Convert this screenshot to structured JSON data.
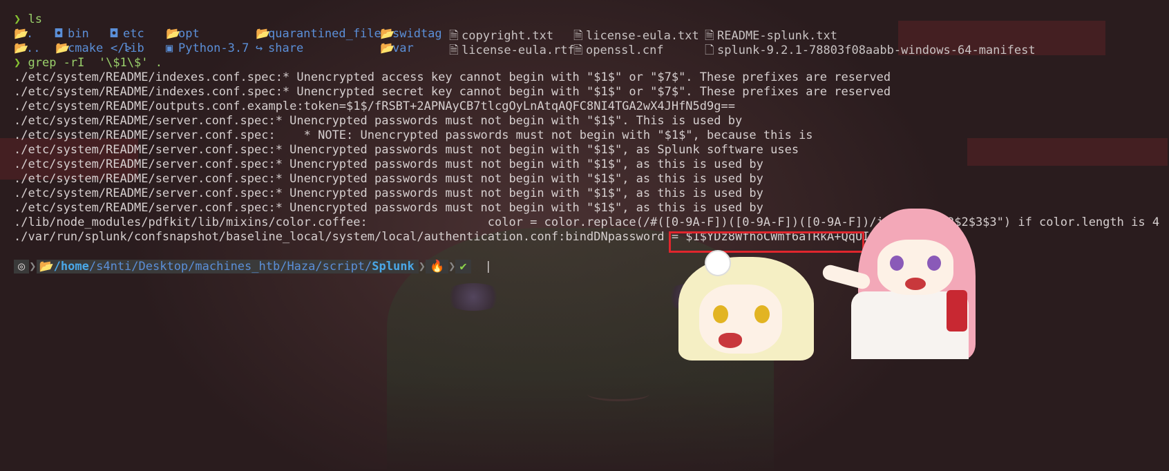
{
  "prompt_symbol": "❯",
  "commands": {
    "ls": "ls",
    "grep": "grep -rI  '\\$1\\$' ."
  },
  "ls_rows": [
    [
      {
        "icon": "📂",
        "name": ".",
        "kind": "dir"
      },
      {
        "icon": "◘",
        "name": "bin",
        "kind": "dir"
      },
      {
        "icon": "◘",
        "name": "etc",
        "kind": "dir"
      },
      {
        "icon": "📂",
        "name": "opt",
        "kind": "dir"
      },
      {
        "icon": "📂",
        "name": "quarantined_files",
        "kind": "dir"
      },
      {
        "icon": "📂",
        "name": "swidtag",
        "kind": "dir"
      },
      {
        "icon": "🗎",
        "name": "copyright.txt",
        "kind": "file"
      },
      {
        "icon": "🗎",
        "name": "license-eula.txt",
        "kind": "file"
      },
      {
        "icon": "🗎",
        "name": "README-splunk.txt",
        "kind": "file"
      }
    ],
    [
      {
        "icon": "📂",
        "name": "..",
        "kind": "dir"
      },
      {
        "icon": "📂",
        "name": "cmake",
        "kind": "dir"
      },
      {
        "icon": "</>",
        "name": "lib",
        "kind": "dir"
      },
      {
        "icon": "▣",
        "name": "Python-3.7",
        "kind": "dir"
      },
      {
        "icon": "↪",
        "name": "share",
        "kind": "dir"
      },
      {
        "icon": "📂",
        "name": "var",
        "kind": "dir"
      },
      {
        "icon": "🗎",
        "name": "license-eula.rtf",
        "kind": "file"
      },
      {
        "icon": "🗎",
        "name": "openssl.cnf",
        "kind": "file"
      },
      {
        "icon": "🗋",
        "name": "splunk-9.2.1-78803f08aabb-windows-64-manifest",
        "kind": "file"
      }
    ]
  ],
  "grep_output": [
    "./etc/system/README/indexes.conf.spec:* Unencrypted access key cannot begin with \"$1$\" or \"$7$\". These prefixes are reserved",
    "./etc/system/README/indexes.conf.spec:* Unencrypted secret key cannot begin with \"$1$\" or \"$7$\". These prefixes are reserved",
    "./etc/system/README/outputs.conf.example:token=$1$/fRSBT+2APNAyCB7tlcgOyLnAtqAQFC8NI4TGA2wX4JHfN5d9g==",
    "./etc/system/README/server.conf.spec:* Unencrypted passwords must not begin with \"$1$\". This is used by",
    "./etc/system/README/server.conf.spec:    * NOTE: Unencrypted passwords must not begin with \"$1$\", because this is",
    "./etc/system/README/server.conf.spec:* Unencrypted passwords must not begin with \"$1$\", as Splunk software uses",
    "./etc/system/README/server.conf.spec:* Unencrypted passwords must not begin with \"$1$\", as this is used by",
    "./etc/system/README/server.conf.spec:* Unencrypted passwords must not begin with \"$1$\", as this is used by",
    "./etc/system/README/server.conf.spec:* Unencrypted passwords must not begin with \"$1$\", as this is used by",
    "./etc/system/README/server.conf.spec:* Unencrypted passwords must not begin with \"$1$\", as this is used by",
    "./lib/node_modules/pdfkit/lib/mixins/color.coffee:                 color = color.replace(/#([0-9A-F])([0-9A-F])([0-9A-F])/i, \"#$1$1$2$2$3$3\") if color.length is 4",
    "./var/run/splunk/confsnapshot/baseline_local/system/local/authentication.conf:bindDNpassword = $1$YDz8WfhoCWmf6aTRkA+QqUI="
  ],
  "status_bar": {
    "os_icon": "◎",
    "folder_icon": "📂",
    "path_prefix": "/",
    "path_home": "home",
    "path_middle": "/s4nti/Desktop/machines_htb/Haza/script/",
    "path_last": "Splunk",
    "separator": "❯",
    "flame_icon": "🔥",
    "check_icon": "✔",
    "cursor": "|"
  },
  "colors": {
    "highlight_box": "#e0262d",
    "prompt": "#86c232",
    "directory": "#5b8fd8"
  }
}
